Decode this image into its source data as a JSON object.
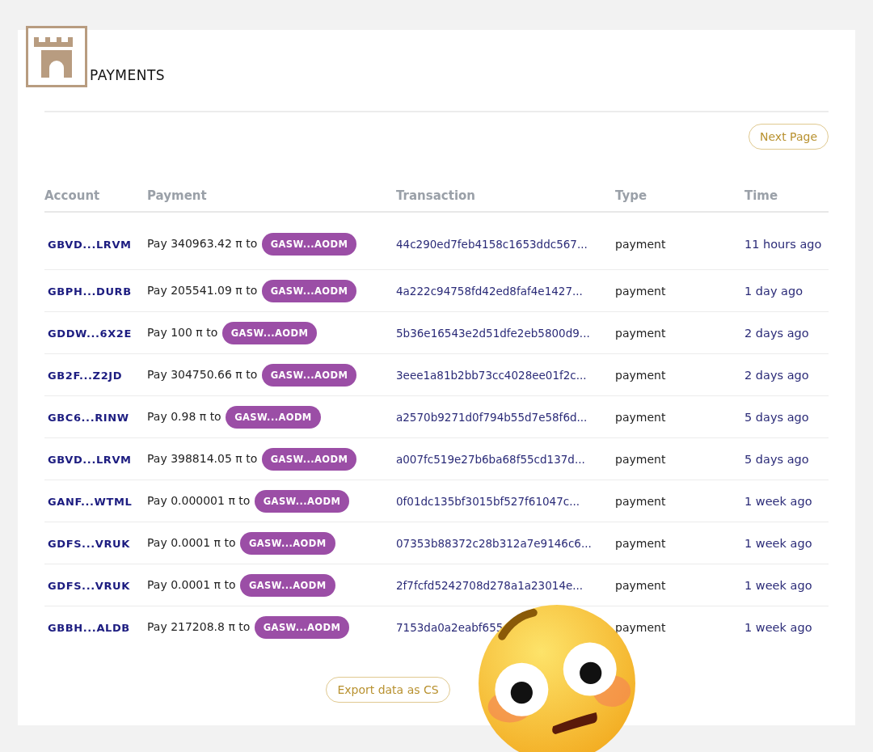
{
  "title": "PAYMENTS",
  "next_button": "Next Page",
  "table": {
    "columns": [
      "Account",
      "Payment",
      "Transaction",
      "Type",
      "Time"
    ],
    "rows": [
      {
        "account": "GBVD...LRVM",
        "payment": "Pay 340963.42 π to",
        "recipient": "GASW...AODM",
        "transaction": "44c290ed7feb4158c1653ddc567...",
        "type": "payment",
        "time": "11 hours ago"
      },
      {
        "account": "GBPH...DURB",
        "payment": "Pay 205541.09 π to",
        "recipient": "GASW...AODM",
        "transaction": "4a222c94758fd42ed8faf4e1427...",
        "type": "payment",
        "time": "1 day ago"
      },
      {
        "account": "GDDW...6X2E",
        "payment": "Pay 100 π to",
        "recipient": "GASW...AODM",
        "transaction": "5b36e16543e2d51dfe2eb5800d9...",
        "type": "payment",
        "time": "2 days ago"
      },
      {
        "account": "GB2F...Z2JD",
        "payment": "Pay 304750.66 π to",
        "recipient": "GASW...AODM",
        "transaction": "3eee1a81b2bb73cc4028ee01f2c...",
        "type": "payment",
        "time": "2 days ago"
      },
      {
        "account": "GBC6...RINW",
        "payment": "Pay 0.98 π to",
        "recipient": "GASW...AODM",
        "transaction": "a2570b9271d0f794b55d7e58f6d...",
        "type": "payment",
        "time": "5 days ago"
      },
      {
        "account": "GBVD...LRVM",
        "payment": "Pay 398814.05 π to",
        "recipient": "GASW...AODM",
        "transaction": "a007fc519e27b6ba68f55cd137d...",
        "type": "payment",
        "time": "5 days ago"
      },
      {
        "account": "GANF...WTML",
        "payment": "Pay 0.000001 π to",
        "recipient": "GASW...AODM",
        "transaction": "0f01dc135bf3015bf527f61047c...",
        "type": "payment",
        "time": "1 week ago"
      },
      {
        "account": "GDFS...VRUK",
        "payment": "Pay 0.0001 π to",
        "recipient": "GASW...AODM",
        "transaction": "07353b88372c28b312a7e9146c6...",
        "type": "payment",
        "time": "1 week ago"
      },
      {
        "account": "GDFS...VRUK",
        "payment": "Pay 0.0001 π to",
        "recipient": "GASW...AODM",
        "transaction": "2f7fcfd5242708d278a1a23014e...",
        "type": "payment",
        "time": "1 week ago"
      },
      {
        "account": "GBBH...ALDB",
        "payment": "Pay 217208.8 π to",
        "recipient": "GASW...AODM",
        "transaction": "7153da0a2eabf655",
        "type": "payment",
        "time": "1 week ago"
      }
    ]
  },
  "export_button": "Export data as CS"
}
